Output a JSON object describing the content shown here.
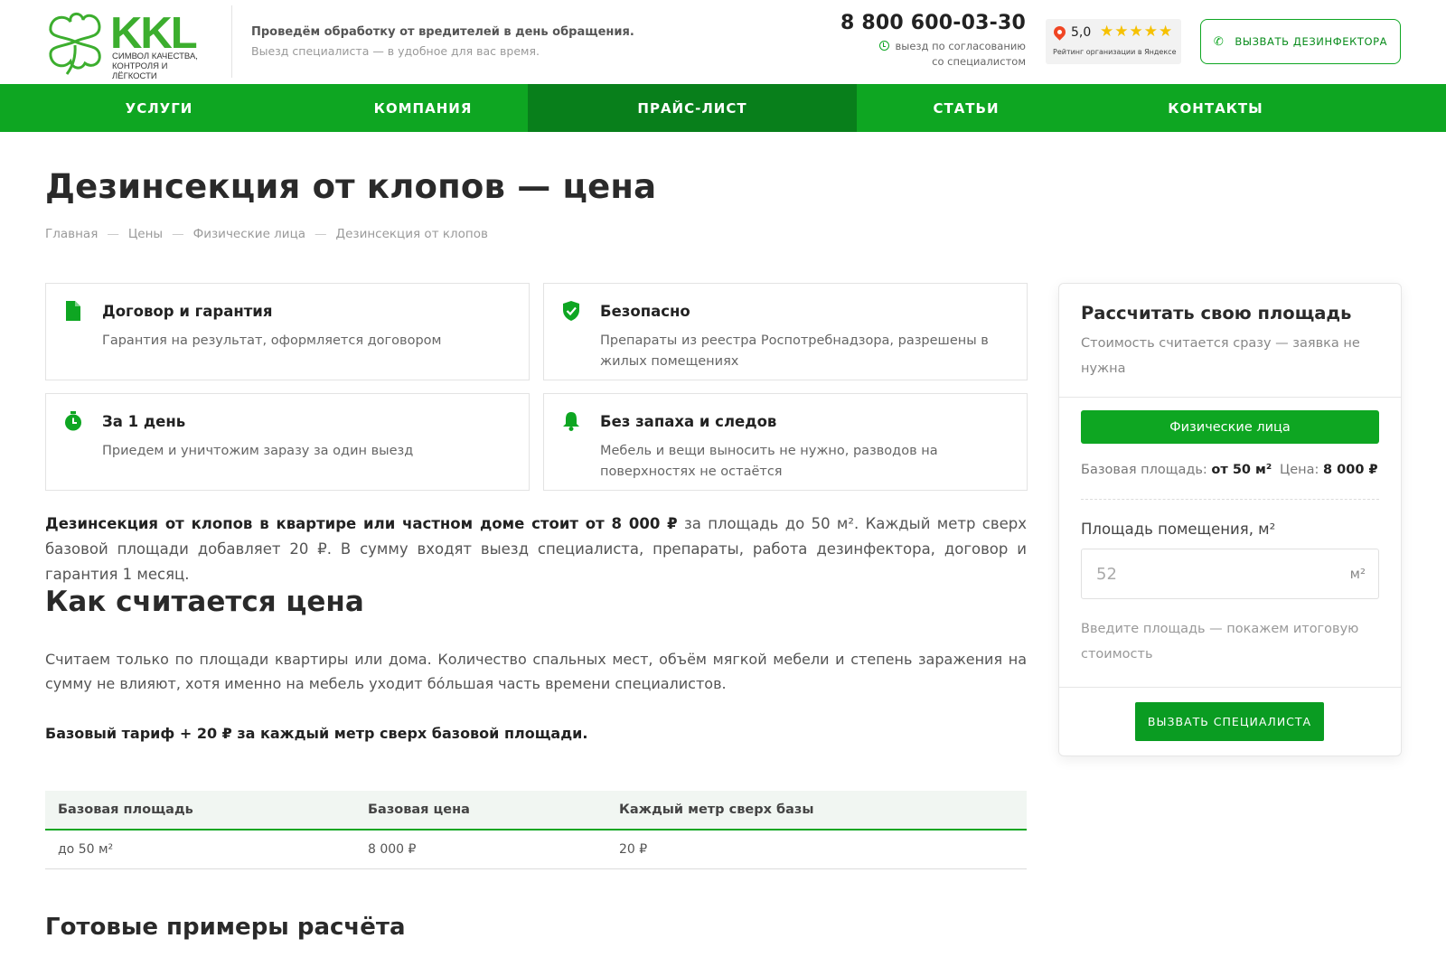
{
  "header": {
    "logo_text": "KKL",
    "logo_tagline": "символ качества, контроля и лёгкости",
    "tagline_main": "Проведём обработку от вредителей в день обращения.",
    "tagline_sub": "Выезд специалиста — в удобное для вас время.",
    "phone": "8 800 600-03-30",
    "visit_line1": "выезд по согласованию",
    "visit_line2": "со специалистом",
    "rating_score": "5,0",
    "rating_stars": "★★★★★",
    "rating_caption": "Рейтинг организации в Яндексе",
    "call_button": "вызвать дезинфектора"
  },
  "nav": [
    {
      "label": "УСЛУГИ",
      "active": false
    },
    {
      "label": "КОМПАНИЯ",
      "active": false
    },
    {
      "label": "ПРАЙС-ЛИСТ",
      "active": true
    },
    {
      "label": "СТАТЬИ",
      "active": false
    },
    {
      "label": "КОНТАКТЫ",
      "active": false
    }
  ],
  "page": {
    "title": "Дезинсекция от клопов — цена",
    "breadcrumb": [
      "Главная",
      "Цены",
      "Физические лица",
      "Дезинсекция от клопов"
    ],
    "breadcrumb_sep": "—"
  },
  "features": [
    {
      "icon": "document-icon",
      "title": "Договор и гарантия",
      "desc": "Гарантия на результат, оформляется договором"
    },
    {
      "icon": "shield-check-icon",
      "title": "Безопасно",
      "desc": "Препараты из реестра Роспотребнадзора, разрешены в жилых помещениях"
    },
    {
      "icon": "clock-icon",
      "title": "За 1 день",
      "desc": "Приедем и уничтожим заразу за один выезд"
    },
    {
      "icon": "bell-icon",
      "title": "Без запаха и следов",
      "desc": "Мебель и вещи выносить не нужно, разводов на поверхностях не остаётся"
    }
  ],
  "intro": {
    "bold": "Дезинсекция от клопов в квартире или частном доме стоит от 8 000 ₽",
    "rest": " за площадь до 50 м². Каждый метр сверх базовой площади добавляет 20 ₽. В сумму входят выезд специалиста, препараты, работа дезинфектора, договор и гарантия 1 месяц."
  },
  "section1": {
    "heading": "Как считается цена",
    "paragraph": "Считаем только по площади квартиры или дома. Количество спальных мест, объём мягкой мебели и степень заражения на сумму не влияют, хотя именно на мебель уходит бóльшая часть времени специалистов.",
    "bold_line": "Базовый тариф + 20 ₽ за каждый метр сверх базовой площади."
  },
  "price_table": {
    "headers": [
      "Базовая площадь",
      "Базовая цена",
      "Каждый метр сверх базы"
    ],
    "rows": [
      [
        "до 50 м²",
        "8 000 ₽",
        "20 ₽"
      ]
    ]
  },
  "section2": {
    "heading": "Готовые примеры расчёта"
  },
  "calculator": {
    "title": "Рассчитать свою площадь",
    "subtitle": "Стоимость считается сразу — заявка не нужна",
    "tab_label": "Физические лица",
    "base_area_label": "Базовая площадь:",
    "base_area_value": "от 50 м²",
    "price_label": "Цена:",
    "price_value": "8 000 ₽",
    "area_label": "Площадь помещения, м²",
    "area_placeholder": "52",
    "area_unit": "м²",
    "hint": "Введите площадь — покажем итоговую стоимость",
    "submit": "вызвать специалиста"
  },
  "colors": {
    "brand_green": "#0ea622",
    "nav_active": "#087f1b",
    "star": "#f6c100"
  }
}
